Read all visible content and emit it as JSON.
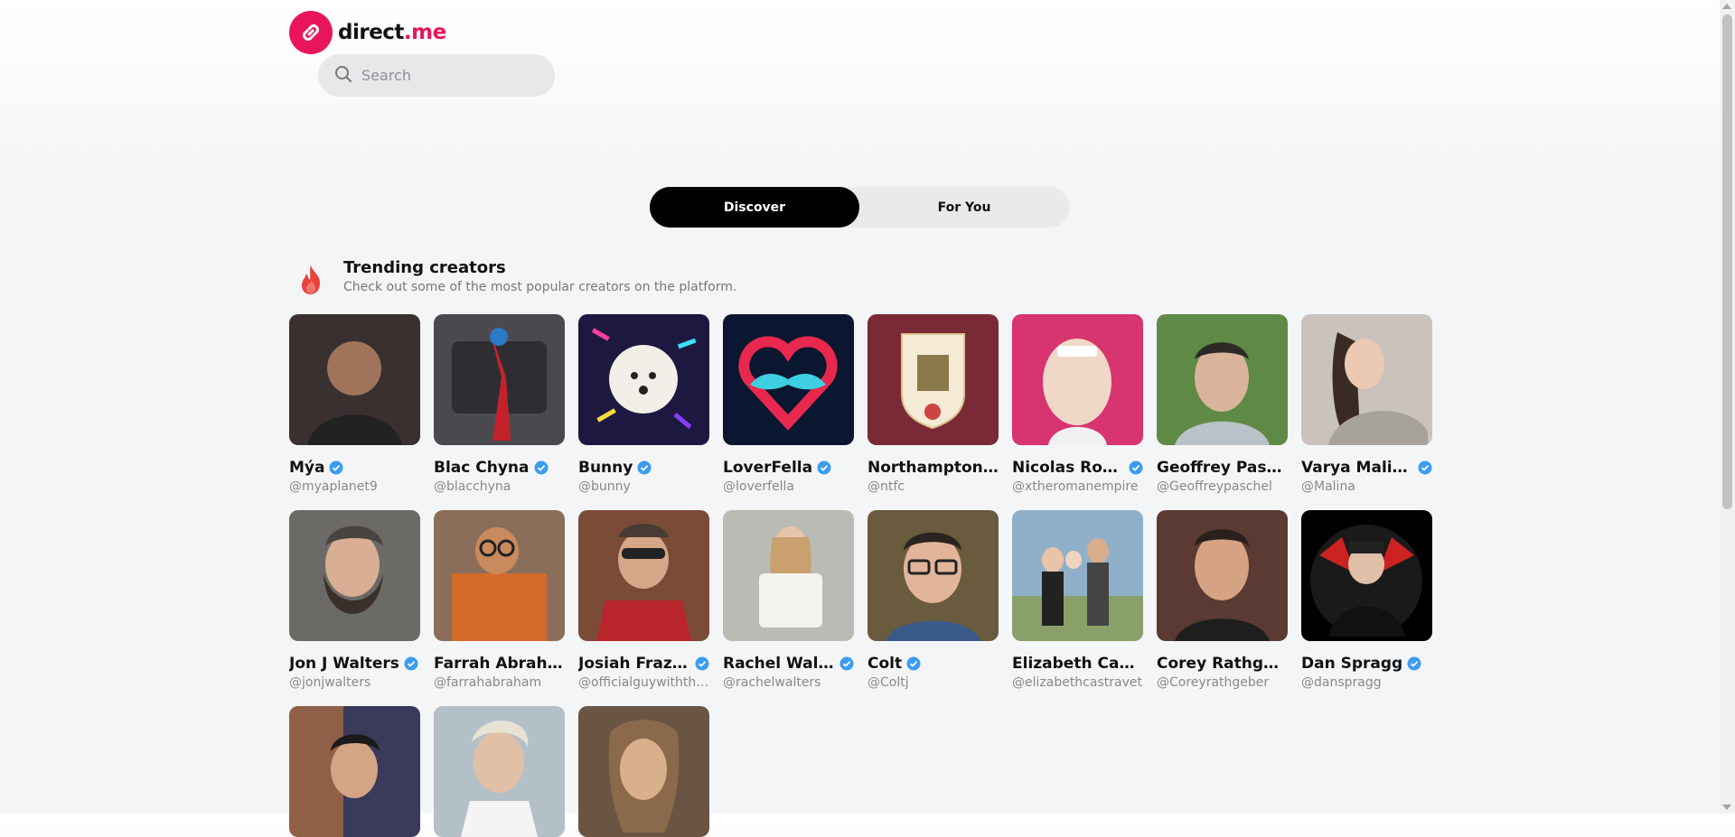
{
  "brand": {
    "name_main": "direct",
    "name_accent": ".me",
    "accent_color": "#e8155c"
  },
  "search": {
    "placeholder": "Search",
    "icon": "search-icon"
  },
  "tabs": [
    {
      "label": "Discover",
      "active": true
    },
    {
      "label": "For You",
      "active": false
    }
  ],
  "section": {
    "icon": "fire-icon",
    "title": "Trending creators",
    "subtitle": "Check out some of the most popular creators on the platform."
  },
  "creators": [
    {
      "name": "Mýa",
      "handle": "@myaplanet9",
      "verified": true,
      "color": "#3a3030"
    },
    {
      "name": "Blac Chyna",
      "handle": "@blacchyna",
      "verified": true,
      "color": "#4a4a4e"
    },
    {
      "name": "Bunny",
      "handle": "@bunny",
      "verified": true,
      "color": "#1d1840"
    },
    {
      "name": "LoverFella",
      "handle": "@loverfella",
      "verified": true,
      "color": "#0b1630"
    },
    {
      "name": "Northampton T...",
      "handle": "@ntfc",
      "verified": false,
      "color": "#7a2a36"
    },
    {
      "name": "Nicolas Roman",
      "handle": "@xtheromanempire",
      "verified": true,
      "color": "#d8346f"
    },
    {
      "name": "Geoffrey Pasche...",
      "handle": "@Geoffreypaschel",
      "verified": false,
      "color": "#5f8a45"
    },
    {
      "name": "Varya Malina",
      "handle": "@Malina",
      "verified": true,
      "color": "#c9c3bc"
    },
    {
      "name": "Jon J Walters",
      "handle": "@jonjwalters",
      "verified": true,
      "color": "#6c6a66"
    },
    {
      "name": "Farrah Abraha...",
      "handle": "@farrahabraham",
      "verified": false,
      "color": "#d46a2a"
    },
    {
      "name": "Josiah Frazier",
      "handle": "@officialguywiththe...",
      "verified": true,
      "color": "#7a4c38"
    },
    {
      "name": "Rachel Walters",
      "handle": "@rachelwalters",
      "verified": true,
      "color": "#b9bbb4"
    },
    {
      "name": "Colt",
      "handle": "@Coltj",
      "verified": true,
      "color": "#6a5a3e"
    },
    {
      "name": "Elizabeth Castra...",
      "handle": "@elizabethcastravet",
      "verified": false,
      "color": "#8fb0c8"
    },
    {
      "name": "Corey Rathgebe...",
      "handle": "@Coreyrathgeber",
      "verified": false,
      "color": "#5a3a32"
    },
    {
      "name": "Dan Spragg",
      "handle": "@danspragg",
      "verified": true,
      "color": "#1a1a1a"
    },
    {
      "name": "",
      "handle": "",
      "verified": false,
      "color": "#3a3a5a"
    },
    {
      "name": "",
      "handle": "",
      "verified": false,
      "color": "#b4c0c8"
    },
    {
      "name": "",
      "handle": "",
      "verified": false,
      "color": "#6a5444"
    }
  ]
}
